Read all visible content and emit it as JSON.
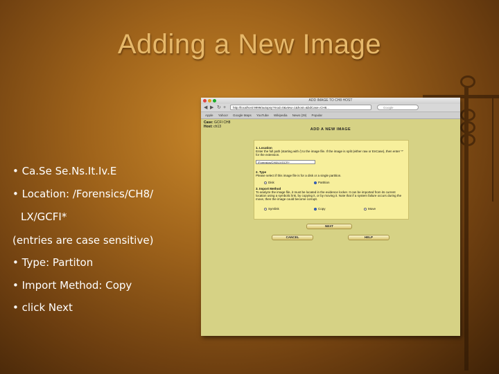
{
  "slide": {
    "title": "Adding a New Image",
    "bullets": [
      "• Ca.Se Se.Ns.It.Iv.E",
      "• Location: /Forensics/CH8/",
      "LX/GCFI*",
      "(entries are case sensitive)",
      "• Type: Partiton",
      "• Import Method: Copy",
      "• click Next"
    ]
  },
  "browser": {
    "window_title": "ADD IMAGE TO CH8 HOST",
    "url": "http://localhost:9999/autopsy?mod=0&view=1&host=&bdCase=CH8...",
    "search_placeholder": "Google",
    "nav": {
      "back": "◀",
      "forward": "▶",
      "reload": "↻",
      "add": "+"
    },
    "bookmarks": [
      "Apple",
      "Yahoo!",
      "Google Maps",
      "YouTube",
      "Wikipedia",
      "News (29)",
      "Popular"
    ],
    "case": {
      "case_label": "Case:",
      "case_value": "GCFI CH8",
      "host_label": "Host:",
      "host_value": "ch13"
    },
    "page_heading": "ADD A NEW IMAGE",
    "location": {
      "heading": "1. Location",
      "text": "Enter the full path (starting with /) to the image file. If the image is split (either raw or EnCase), then enter '*' for the extension.",
      "value": "/Forensics/CH8/LX/GCFI*"
    },
    "type": {
      "heading": "2. Type",
      "text": "Please select if this image file is for a disk or a single partition.",
      "options": [
        "Disk",
        "Partition"
      ],
      "selected": "Partition"
    },
    "import": {
      "heading": "3. Import Method",
      "text": "To analyze the image file, it must be located in the evidence locker. It can be imported from its current location using a symbolic link, by copying it, or by moving it. Note that if a system failure occurs during the move, then the image could become corrupt.",
      "options": [
        "Symlink",
        "Copy",
        "Move"
      ],
      "selected": "Copy"
    },
    "buttons": {
      "next": "NEXT",
      "cancel": "CANCEL",
      "help": "HELP"
    }
  },
  "colors": {
    "slide_title": "#e6b86a",
    "page_bg": "#d6d285",
    "panel_bg": "#f7ef9c"
  }
}
